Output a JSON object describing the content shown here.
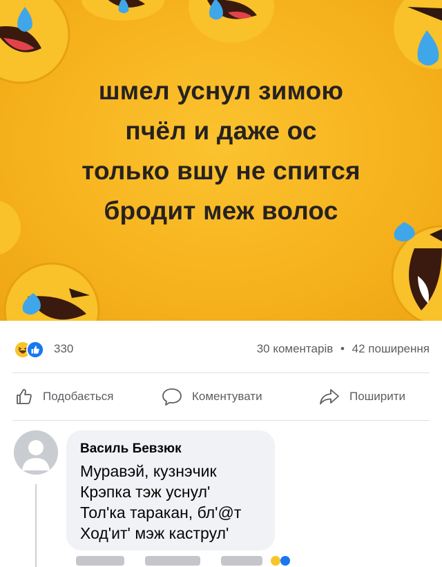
{
  "post": {
    "image": {
      "background_color": "#f6b21d",
      "lines": [
        "шмел уснул зимою",
        "пчёл и даже ос",
        "только вшу не спится",
        "бродит меж волос"
      ],
      "decorations": [
        "laughing-emoji",
        "teardrop"
      ]
    },
    "stats": {
      "reaction_icons": [
        "haha",
        "like"
      ],
      "reactions_count": "330",
      "comments": "30 коментарів",
      "separator": "•",
      "shares": "42 поширення"
    },
    "actions": {
      "like_label": "Подобається",
      "comment_label": "Коментувати",
      "share_label": "Поширити"
    }
  },
  "comment": {
    "author": "Василь Бевзюк",
    "lines": [
      "Муравэй,  кузнэчик",
      "Крэпка тэж уснул'",
      "Тол'ка таракан, бл'@т",
      "Ход'ит' мэж каструл'"
    ]
  },
  "colors": {
    "accent_like": "#1877f2",
    "haha_yellow": "#f7c52b",
    "secondary_text": "#5b5d61",
    "bubble_bg": "#f0f2f5"
  }
}
